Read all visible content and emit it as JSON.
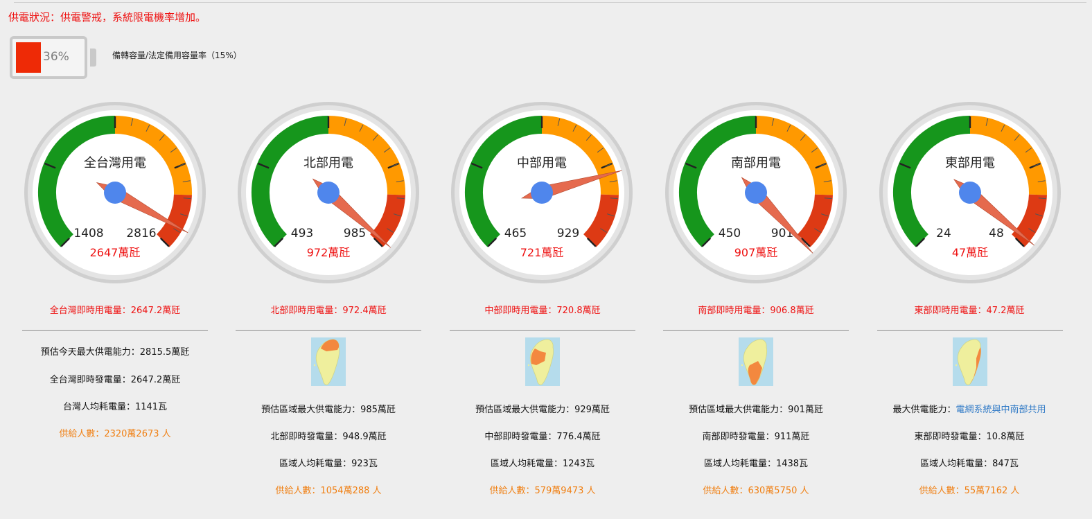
{
  "status": "供電狀況：供電警戒，系統限電機率增加。",
  "battery": {
    "percent_label": "36%",
    "fill_ratio": 0.36,
    "legend": "備轉容量/法定備用容量率（15%）",
    "fill_color": "#ee2a06"
  },
  "colors": {
    "green": "#16961c",
    "orange": "#ff9900",
    "red": "#dd3a14",
    "needle": "#e56a4e",
    "hub": "#4f86ec",
    "alert": "#ee1111",
    "people": "#f07f12",
    "link": "#2f79c6"
  },
  "gauges": [
    {
      "title": "全台灣用電",
      "mid_label": "1408",
      "max_label": "2816",
      "value_label": "2647萬瓩",
      "value": 2647,
      "max": 2816
    },
    {
      "title": "北部用電",
      "mid_label": "493",
      "max_label": "985",
      "value_label": "972萬瓩",
      "value": 972,
      "max": 985
    },
    {
      "title": "中部用電",
      "mid_label": "465",
      "max_label": "929",
      "value_label": "721萬瓩",
      "value": 721,
      "max": 929
    },
    {
      "title": "南部用電",
      "mid_label": "450",
      "max_label": "901",
      "value_label": "907萬瓩",
      "value": 907,
      "max": 901
    },
    {
      "title": "東部用電",
      "mid_label": "24",
      "max_label": "48",
      "value_label": "47萬瓩",
      "value": 47,
      "max": 48
    }
  ],
  "regions": [
    {
      "now_usage": "全台灣即時用電量：2647.2萬瓩",
      "lines": [
        "預估今天最大供電能力：2815.5萬瓩",
        "全台灣即時發電量：2647.2萬瓩",
        "台灣人均耗電量：1141瓦"
      ],
      "people": "供給人數：2320萬2673 人"
    },
    {
      "now_usage": "北部即時用電量：972.4萬瓩",
      "map_icon": "taiwan-north-map-icon",
      "lines": [
        "預估區域最大供電能力：985萬瓩",
        "北部即時發電量：948.9萬瓩",
        "區域人均耗電量：923瓦"
      ],
      "people": "供給人數：1054萬288 人"
    },
    {
      "now_usage": "中部即時用電量：720.8萬瓩",
      "map_icon": "taiwan-central-map-icon",
      "lines": [
        "預估區域最大供電能力：929萬瓩",
        "中部即時發電量：776.4萬瓩",
        "區域人均耗電量：1243瓦"
      ],
      "people": "供給人數：579萬9473 人"
    },
    {
      "now_usage": "南部即時用電量：906.8萬瓩",
      "map_icon": "taiwan-south-map-icon",
      "lines": [
        "預估區域最大供電能力：901萬瓩",
        "南部即時發電量：911萬瓩",
        "區域人均耗電量：1438瓦"
      ],
      "people": "供給人數：630萬5750 人"
    },
    {
      "now_usage": "東部即時用電量：47.2萬瓩",
      "map_icon": "taiwan-east-map-icon",
      "capacity_prefix": "最大供電能力：",
      "capacity_link": "電網系統與中南部共用",
      "lines": [
        "",
        "東部即時發電量：10.8萬瓩",
        "區域人均耗電量：847瓦"
      ],
      "people": "供給人數：55萬7162 人"
    }
  ]
}
